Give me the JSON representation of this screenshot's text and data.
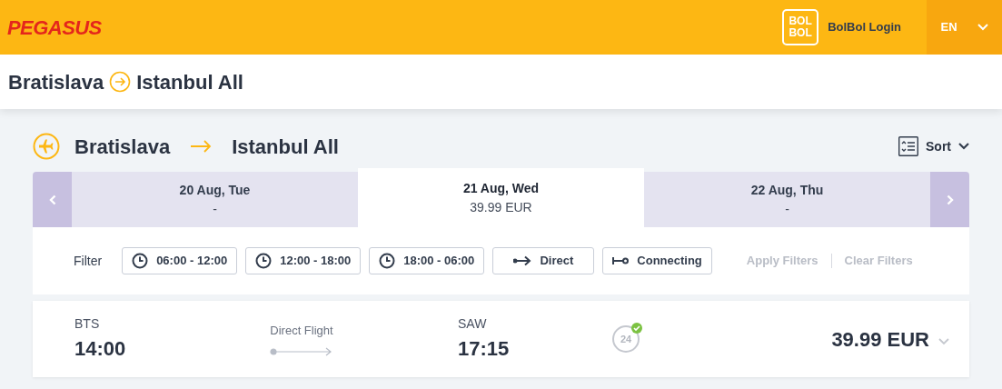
{
  "header": {
    "logo": "PEGASUS",
    "bolbol_logo": [
      "BOL",
      "BOL"
    ],
    "login": "BolBol Login",
    "language": "EN"
  },
  "route_bar": {
    "origin": "Bratislava",
    "destination": "Istanbul All"
  },
  "results": {
    "origin": "Bratislava",
    "destination": "Istanbul All",
    "sort": "Sort",
    "dates": [
      {
        "date": "20 Aug, Tue",
        "price": "-",
        "selected": false
      },
      {
        "date": "21 Aug, Wed",
        "price": "39.99 EUR",
        "selected": true
      },
      {
        "date": "22 Aug, Thu",
        "price": "-",
        "selected": false
      }
    ],
    "filter_label": "Filter",
    "filters": [
      {
        "kind": "time",
        "label": "06:00 - 12:00"
      },
      {
        "kind": "time",
        "label": "12:00 - 18:00"
      },
      {
        "kind": "time",
        "label": "18:00 - 06:00"
      },
      {
        "kind": "direct",
        "label": "Direct"
      },
      {
        "kind": "connecting",
        "label": "Connecting"
      }
    ],
    "actions": [
      {
        "label": "Apply Filters",
        "disabled": true
      },
      {
        "label": "Clear Filters",
        "disabled": true
      }
    ],
    "flight": {
      "from_code": "BTS",
      "from_time": "14:00",
      "type": "Direct Flight",
      "to_code": "SAW",
      "to_time": "17:15",
      "badge": "24",
      "price": "39.99 EUR"
    }
  }
}
